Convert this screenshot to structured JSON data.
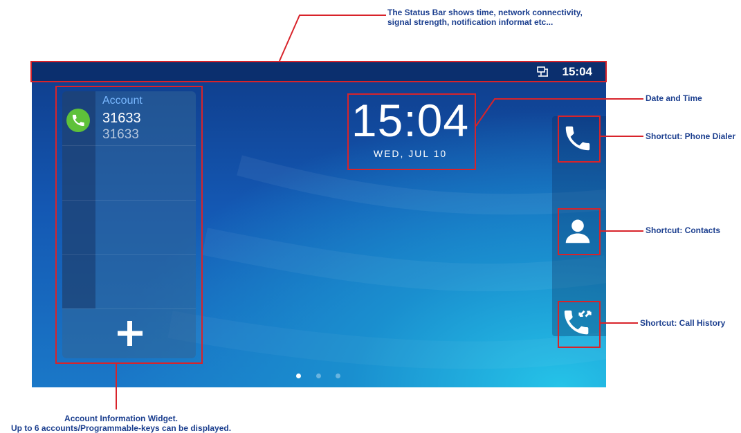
{
  "annotations": {
    "status_bar_line1": "The Status Bar shows time, network connectivity,",
    "status_bar_line2": "signal strength, notification informat etc...",
    "date_time": "Date and Time",
    "phone_dialer": "Shortcut: Phone Dialer",
    "contacts": "Shortcut: Contacts",
    "call_history": "Shortcut: Call History",
    "account_widget_line1": "Account Information Widget.",
    "account_widget_line2": "Up to 6 accounts/Programmable-keys can be displayed."
  },
  "status_bar": {
    "time": "15:04",
    "network_icon": "ethernet-icon"
  },
  "account_widget": {
    "label": "Account",
    "number": "31633",
    "sub_number": "31633",
    "status_icon": "phone-icon",
    "status_color": "#5ec13a",
    "add_icon": "plus-icon"
  },
  "clock": {
    "time": "15:04",
    "date": "WED, JUL 10"
  },
  "shortcuts": [
    {
      "icon": "phone-icon"
    },
    {
      "icon": "contact-icon"
    },
    {
      "icon": "call-history-icon"
    }
  ],
  "pager": {
    "total_pages": 3,
    "current_page": 1
  },
  "colors": {
    "annotation_text": "#1c3f8f",
    "annotation_line": "#d8232a",
    "status_bar_bg": "#0b2f6e"
  }
}
